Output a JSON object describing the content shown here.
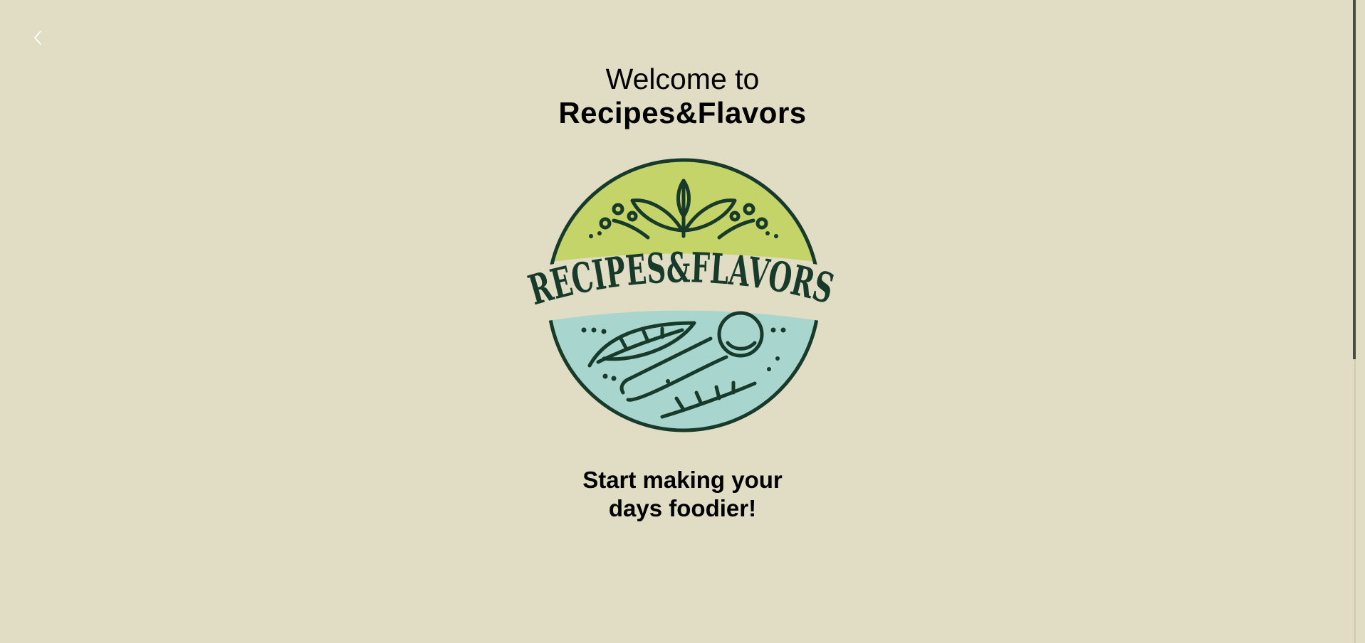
{
  "header": {
    "back_icon": "chevron-left-icon"
  },
  "welcome": {
    "line1": "Welcome to",
    "brand": "Recipes&Flavors"
  },
  "logo": {
    "text": "RECIPES&FLAVORS",
    "colors": {
      "top": "#c5d468",
      "bottom": "#a8d5cd",
      "ink": "#173a2b",
      "band": "#e1ddc4"
    }
  },
  "tagline": {
    "line1": "Start making your",
    "line2": "days foodier!"
  },
  "colors": {
    "background": "#e1ddc4",
    "text": "#000000"
  }
}
